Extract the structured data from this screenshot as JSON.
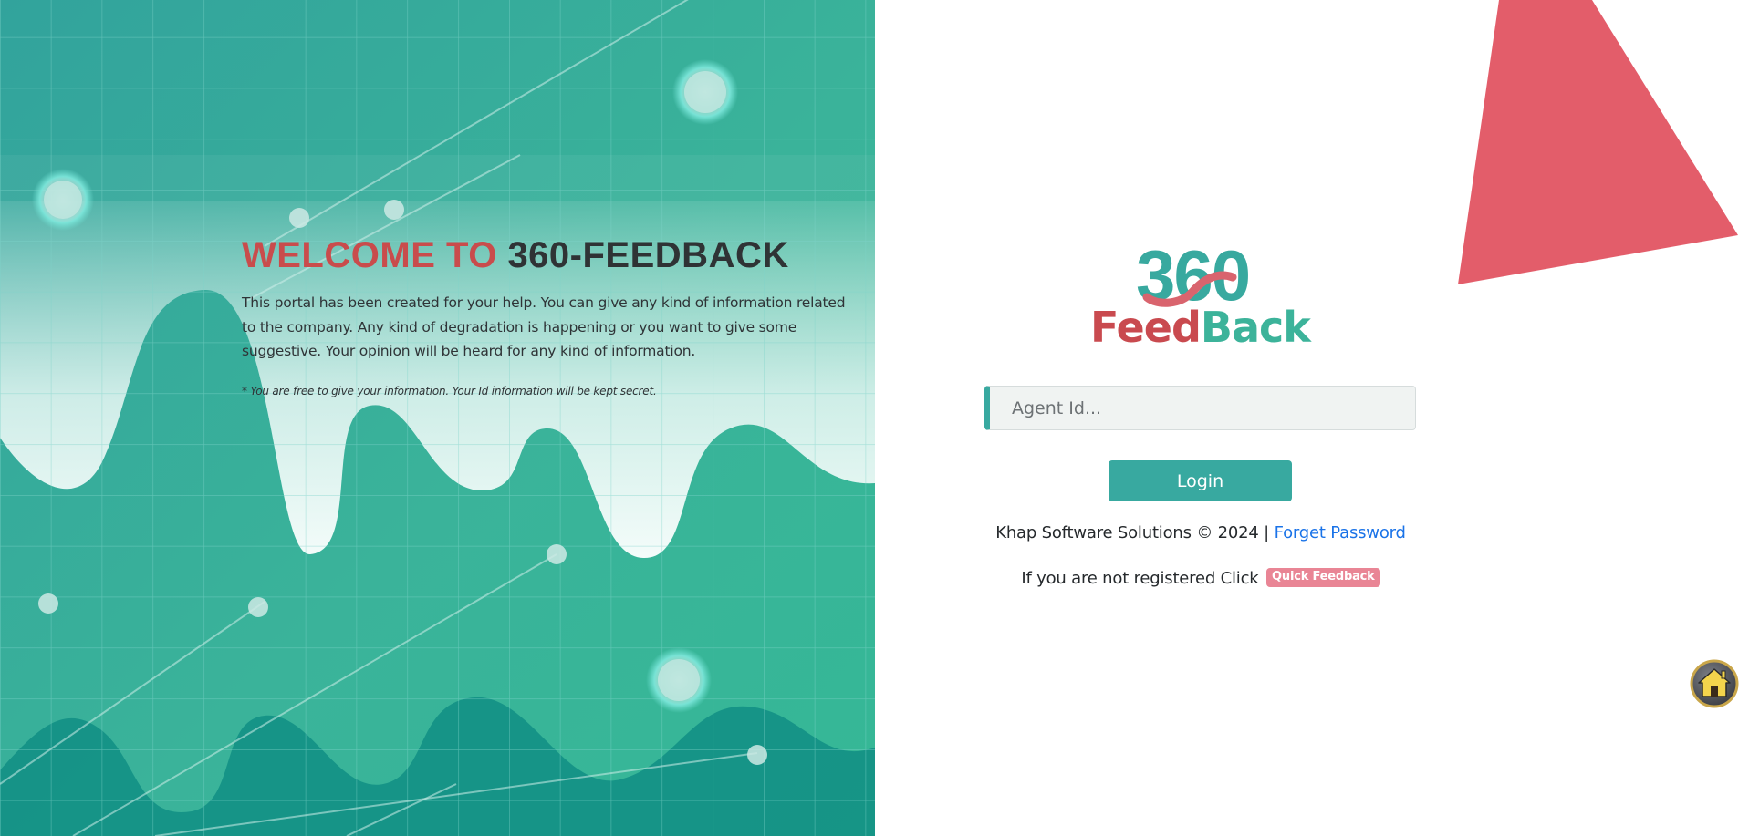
{
  "hero": {
    "title_part1": "WELCOME TO",
    "title_part2": "360-FEEDBACK",
    "description": "This portal has been created for your help. You can give any kind of information related to the company. Any kind of degradation is happening or you want to give some suggestive. Your opinion will be heard for any kind of information.",
    "note": "* You are free to give your information. Your Id information will be kept secret."
  },
  "logo": {
    "number": "360",
    "word_part1": "Feed",
    "word_part2": "Back"
  },
  "login": {
    "agent_placeholder": "Agent Id...",
    "agent_value": "",
    "button_label": "Login"
  },
  "footer": {
    "copyright": "Khap Software Solutions © 2024 |",
    "forget_password": "Forget Password",
    "register_text": "If you are not registered Click",
    "quick_feedback": "Quick Feedback"
  },
  "icons": {
    "home": "home-icon"
  },
  "colors": {
    "accent_teal": "#38a9a0",
    "title_red": "#c94c4c",
    "triangle_red": "#e35d6a",
    "link_blue": "#1a73e8",
    "badge_pink": "#e98595"
  }
}
